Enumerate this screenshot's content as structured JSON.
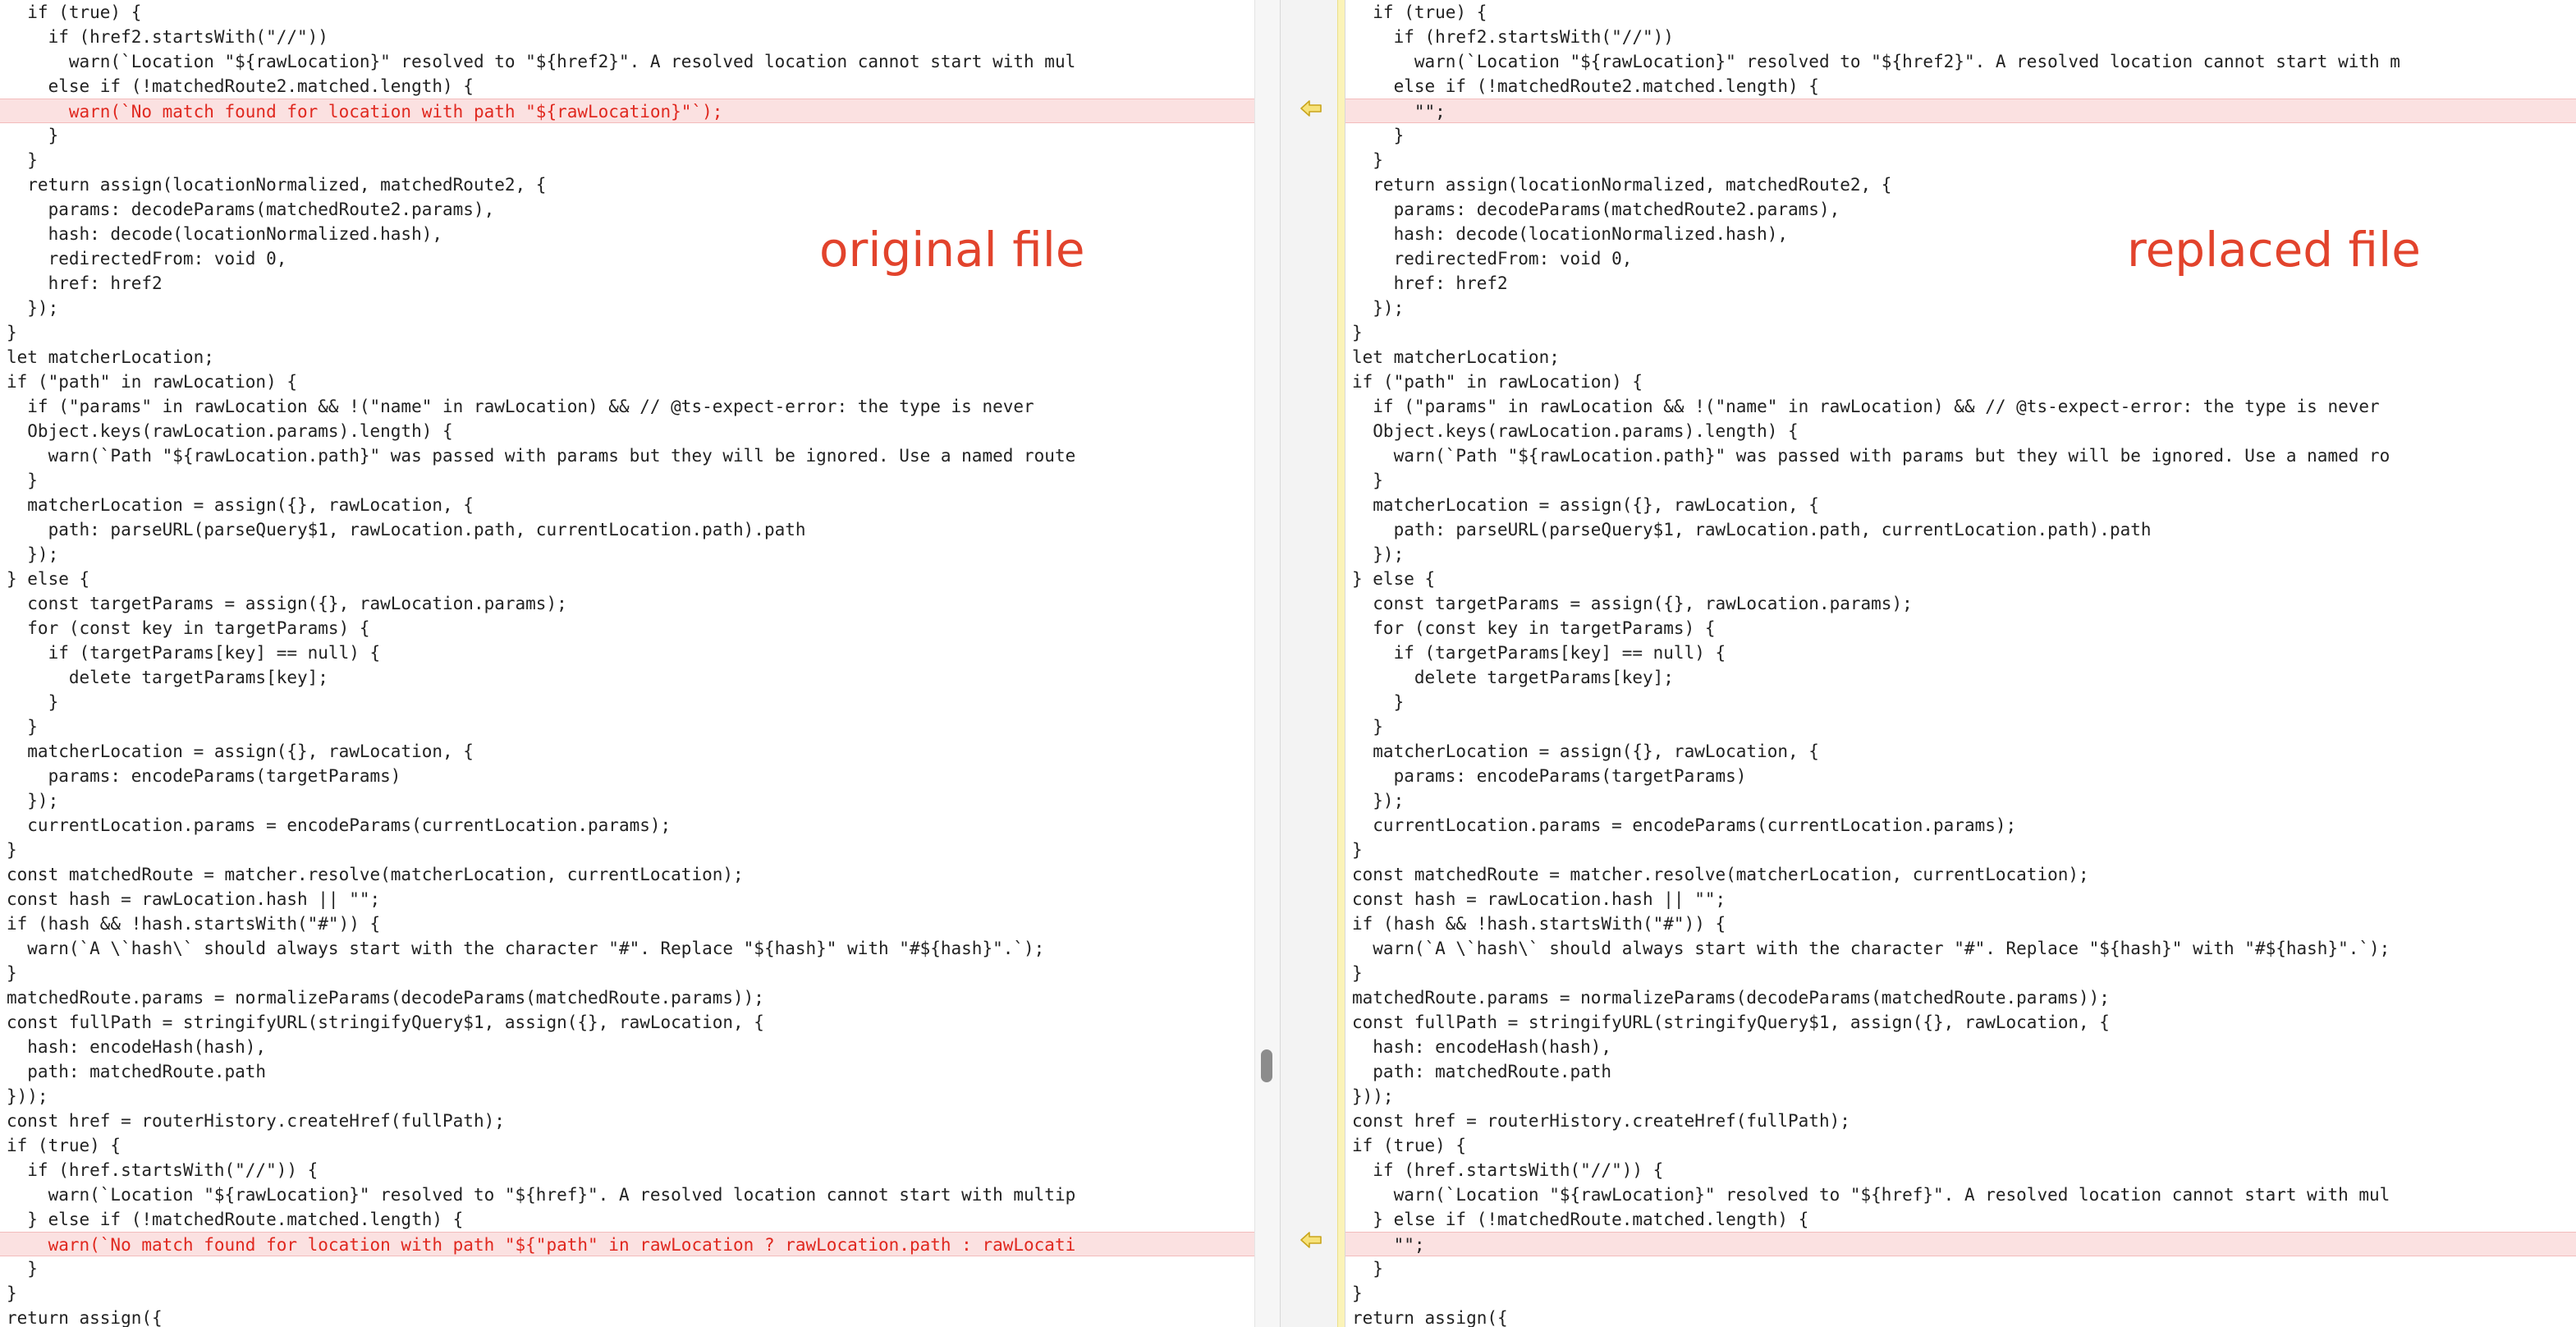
{
  "labels": {
    "original": "original file",
    "replaced": "replaced file"
  },
  "colors": {
    "annotation": "#e2432c",
    "changed_line_bg": "#fbe1e1",
    "changed_line_text": "#e0281f",
    "gutter_strip": "#fbf3b8",
    "arrow": "#c9a51c"
  },
  "icons": {
    "gutter_arrow": "arrow-left-icon"
  },
  "left_lines": [
    {
      "text": "  if (true) {",
      "changed": false
    },
    {
      "text": "    if (href2.startsWith(\"//\"))",
      "changed": false
    },
    {
      "text": "      warn(`Location \"${rawLocation}\" resolved to \"${href2}\". A resolved location cannot start with mul",
      "changed": false
    },
    {
      "text": "    else if (!matchedRoute2.matched.length) {",
      "changed": false
    },
    {
      "text": "      warn(`No match found for location with path \"${rawLocation}\"`);",
      "changed": true
    },
    {
      "text": "    }",
      "changed": false
    },
    {
      "text": "  }",
      "changed": false
    },
    {
      "text": "  return assign(locationNormalized, matchedRoute2, {",
      "changed": false
    },
    {
      "text": "    params: decodeParams(matchedRoute2.params),",
      "changed": false
    },
    {
      "text": "    hash: decode(locationNormalized.hash),",
      "changed": false
    },
    {
      "text": "    redirectedFrom: void 0,",
      "changed": false
    },
    {
      "text": "    href: href2",
      "changed": false
    },
    {
      "text": "  });",
      "changed": false
    },
    {
      "text": "}",
      "changed": false
    },
    {
      "text": "let matcherLocation;",
      "changed": false
    },
    {
      "text": "if (\"path\" in rawLocation) {",
      "changed": false
    },
    {
      "text": "  if (\"params\" in rawLocation && !(\"name\" in rawLocation) && // @ts-expect-error: the type is never",
      "changed": false
    },
    {
      "text": "  Object.keys(rawLocation.params).length) {",
      "changed": false
    },
    {
      "text": "    warn(`Path \"${rawLocation.path}\" was passed with params but they will be ignored. Use a named route",
      "changed": false
    },
    {
      "text": "  }",
      "changed": false
    },
    {
      "text": "  matcherLocation = assign({}, rawLocation, {",
      "changed": false
    },
    {
      "text": "    path: parseURL(parseQuery$1, rawLocation.path, currentLocation.path).path",
      "changed": false
    },
    {
      "text": "  });",
      "changed": false
    },
    {
      "text": "} else {",
      "changed": false
    },
    {
      "text": "  const targetParams = assign({}, rawLocation.params);",
      "changed": false
    },
    {
      "text": "  for (const key in targetParams) {",
      "changed": false
    },
    {
      "text": "    if (targetParams[key] == null) {",
      "changed": false
    },
    {
      "text": "      delete targetParams[key];",
      "changed": false
    },
    {
      "text": "    }",
      "changed": false
    },
    {
      "text": "  }",
      "changed": false
    },
    {
      "text": "  matcherLocation = assign({}, rawLocation, {",
      "changed": false
    },
    {
      "text": "    params: encodeParams(targetParams)",
      "changed": false
    },
    {
      "text": "  });",
      "changed": false
    },
    {
      "text": "  currentLocation.params = encodeParams(currentLocation.params);",
      "changed": false
    },
    {
      "text": "}",
      "changed": false
    },
    {
      "text": "const matchedRoute = matcher.resolve(matcherLocation, currentLocation);",
      "changed": false
    },
    {
      "text": "const hash = rawLocation.hash || \"\";",
      "changed": false
    },
    {
      "text": "if (hash && !hash.startsWith(\"#\")) {",
      "changed": false
    },
    {
      "text": "  warn(`A \\`hash\\` should always start with the character \"#\". Replace \"${hash}\" with \"#${hash}\".`);",
      "changed": false
    },
    {
      "text": "}",
      "changed": false
    },
    {
      "text": "matchedRoute.params = normalizeParams(decodeParams(matchedRoute.params));",
      "changed": false
    },
    {
      "text": "const fullPath = stringifyURL(stringifyQuery$1, assign({}, rawLocation, {",
      "changed": false
    },
    {
      "text": "  hash: encodeHash(hash),",
      "changed": false
    },
    {
      "text": "  path: matchedRoute.path",
      "changed": false
    },
    {
      "text": "}));",
      "changed": false
    },
    {
      "text": "const href = routerHistory.createHref(fullPath);",
      "changed": false
    },
    {
      "text": "if (true) {",
      "changed": false
    },
    {
      "text": "  if (href.startsWith(\"//\")) {",
      "changed": false
    },
    {
      "text": "    warn(`Location \"${rawLocation}\" resolved to \"${href}\". A resolved location cannot start with multip",
      "changed": false
    },
    {
      "text": "  } else if (!matchedRoute.matched.length) {",
      "changed": false
    },
    {
      "text": "    warn(`No match found for location with path \"${\"path\" in rawLocation ? rawLocation.path : rawLocati",
      "changed": true
    },
    {
      "text": "  }",
      "changed": false
    },
    {
      "text": "}",
      "changed": false
    },
    {
      "text": "return assign({",
      "changed": false
    }
  ],
  "right_lines": [
    {
      "text": "  if (true) {",
      "changed": false
    },
    {
      "text": "    if (href2.startsWith(\"//\"))",
      "changed": false
    },
    {
      "text": "      warn(`Location \"${rawLocation}\" resolved to \"${href2}\". A resolved location cannot start with m",
      "changed": false
    },
    {
      "text": "    else if (!matchedRoute2.matched.length) {",
      "changed": false
    },
    {
      "text": "      \"\";",
      "changed": true
    },
    {
      "text": "    }",
      "changed": false
    },
    {
      "text": "  }",
      "changed": false
    },
    {
      "text": "  return assign(locationNormalized, matchedRoute2, {",
      "changed": false
    },
    {
      "text": "    params: decodeParams(matchedRoute2.params),",
      "changed": false
    },
    {
      "text": "    hash: decode(locationNormalized.hash),",
      "changed": false
    },
    {
      "text": "    redirectedFrom: void 0,",
      "changed": false
    },
    {
      "text": "    href: href2",
      "changed": false
    },
    {
      "text": "  });",
      "changed": false
    },
    {
      "text": "}",
      "changed": false
    },
    {
      "text": "let matcherLocation;",
      "changed": false
    },
    {
      "text": "if (\"path\" in rawLocation) {",
      "changed": false
    },
    {
      "text": "  if (\"params\" in rawLocation && !(\"name\" in rawLocation) && // @ts-expect-error: the type is never",
      "changed": false
    },
    {
      "text": "  Object.keys(rawLocation.params).length) {",
      "changed": false
    },
    {
      "text": "    warn(`Path \"${rawLocation.path}\" was passed with params but they will be ignored. Use a named ro",
      "changed": false
    },
    {
      "text": "  }",
      "changed": false
    },
    {
      "text": "  matcherLocation = assign({}, rawLocation, {",
      "changed": false
    },
    {
      "text": "    path: parseURL(parseQuery$1, rawLocation.path, currentLocation.path).path",
      "changed": false
    },
    {
      "text": "  });",
      "changed": false
    },
    {
      "text": "} else {",
      "changed": false
    },
    {
      "text": "  const targetParams = assign({}, rawLocation.params);",
      "changed": false
    },
    {
      "text": "  for (const key in targetParams) {",
      "changed": false
    },
    {
      "text": "    if (targetParams[key] == null) {",
      "changed": false
    },
    {
      "text": "      delete targetParams[key];",
      "changed": false
    },
    {
      "text": "    }",
      "changed": false
    },
    {
      "text": "  }",
      "changed": false
    },
    {
      "text": "  matcherLocation = assign({}, rawLocation, {",
      "changed": false
    },
    {
      "text": "    params: encodeParams(targetParams)",
      "changed": false
    },
    {
      "text": "  });",
      "changed": false
    },
    {
      "text": "  currentLocation.params = encodeParams(currentLocation.params);",
      "changed": false
    },
    {
      "text": "}",
      "changed": false
    },
    {
      "text": "const matchedRoute = matcher.resolve(matcherLocation, currentLocation);",
      "changed": false
    },
    {
      "text": "const hash = rawLocation.hash || \"\";",
      "changed": false
    },
    {
      "text": "if (hash && !hash.startsWith(\"#\")) {",
      "changed": false
    },
    {
      "text": "  warn(`A \\`hash\\` should always start with the character \"#\". Replace \"${hash}\" with \"#${hash}\".`);",
      "changed": false
    },
    {
      "text": "}",
      "changed": false
    },
    {
      "text": "matchedRoute.params = normalizeParams(decodeParams(matchedRoute.params));",
      "changed": false
    },
    {
      "text": "const fullPath = stringifyURL(stringifyQuery$1, assign({}, rawLocation, {",
      "changed": false
    },
    {
      "text": "  hash: encodeHash(hash),",
      "changed": false
    },
    {
      "text": "  path: matchedRoute.path",
      "changed": false
    },
    {
      "text": "}));",
      "changed": false
    },
    {
      "text": "const href = routerHistory.createHref(fullPath);",
      "changed": false
    },
    {
      "text": "if (true) {",
      "changed": false
    },
    {
      "text": "  if (href.startsWith(\"//\")) {",
      "changed": false
    },
    {
      "text": "    warn(`Location \"${rawLocation}\" resolved to \"${href}\". A resolved location cannot start with mul",
      "changed": false
    },
    {
      "text": "  } else if (!matchedRoute.matched.length) {",
      "changed": false
    },
    {
      "text": "    \"\";",
      "changed": true
    },
    {
      "text": "  }",
      "changed": false
    },
    {
      "text": "}",
      "changed": false
    },
    {
      "text": "return assign({",
      "changed": false
    }
  ]
}
